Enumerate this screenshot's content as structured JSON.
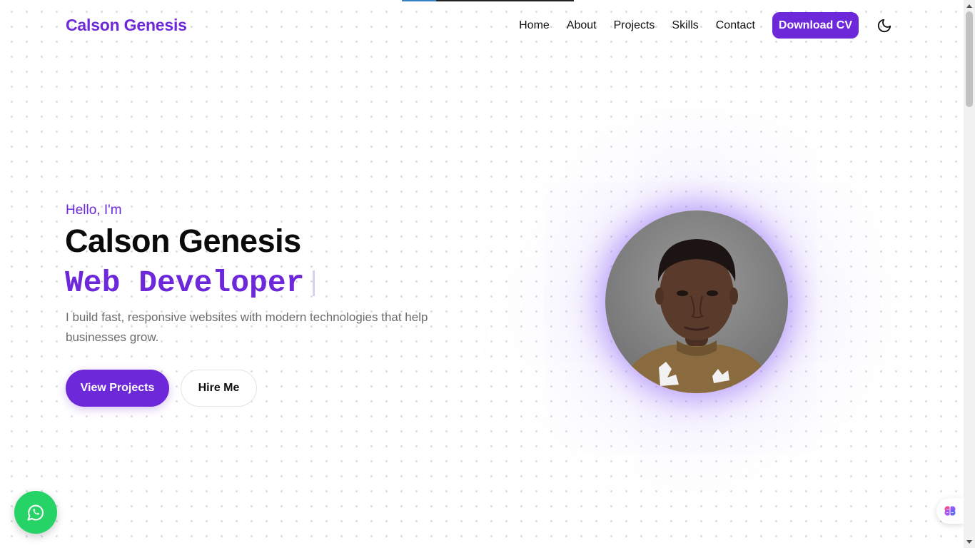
{
  "brand": {
    "name": "Calson Genesis",
    "color": "#6d28d9"
  },
  "nav": {
    "links": [
      "Home",
      "About",
      "Projects",
      "Skills",
      "Contact"
    ],
    "cta_label": "Download CV",
    "theme_icon": "moon-icon"
  },
  "hero": {
    "greeting": "Hello, I'm",
    "name": "Calson Genesis",
    "role": "Web Developer",
    "description": "I build fast, responsive websites with modern technologies that help businesses grow.",
    "primary_button": "View Projects",
    "secondary_button": "Hire Me",
    "avatar_icon": "profile-photo"
  },
  "floating": {
    "whatsapp_icon": "whatsapp-icon",
    "whatsapp_color": "#25d366",
    "assistant_icon": "brain-icon"
  }
}
